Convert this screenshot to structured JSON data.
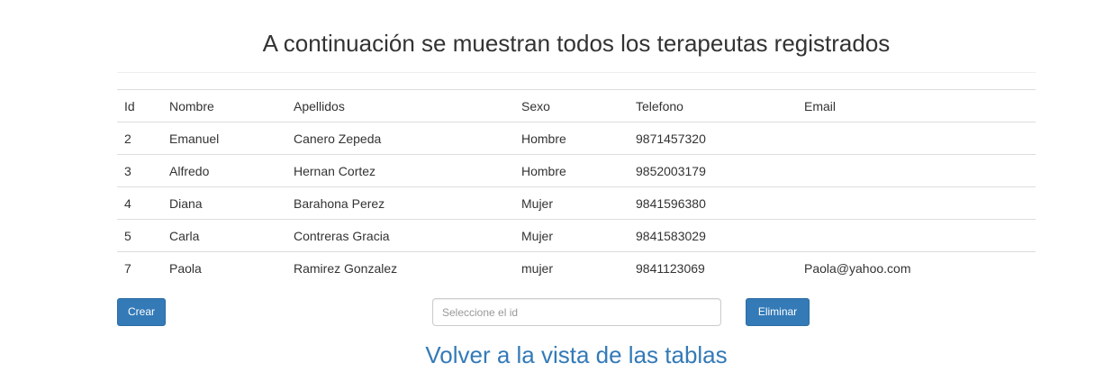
{
  "header": {
    "title": "A continuación se muestran todos los terapeutas registrados"
  },
  "table": {
    "columns": [
      "Id",
      "Nombre",
      "Apellidos",
      "Sexo",
      "Telefono",
      "Email"
    ],
    "rows": [
      [
        "2",
        "Emanuel",
        "Canero Zepeda",
        "Hombre",
        "9871457320",
        ""
      ],
      [
        "3",
        "Alfredo",
        "Hernan Cortez",
        "Hombre",
        "9852003179",
        ""
      ],
      [
        "4",
        "Diana",
        "Barahona Perez",
        "Mujer",
        "9841596380",
        ""
      ],
      [
        "5",
        "Carla",
        "Contreras Gracia",
        "Mujer",
        "9841583029",
        ""
      ],
      [
        "7",
        "Paola",
        "Ramirez Gonzalez",
        "mujer",
        "9841123069",
        "Paola@yahoo.com"
      ]
    ]
  },
  "actions": {
    "create_label": "Crear",
    "id_placeholder": "Seleccione el id",
    "id_value": "",
    "delete_label": "Eliminar"
  },
  "footer": {
    "back_link": "Volver a la vista de las tablas"
  },
  "colors": {
    "primary": "#337ab7",
    "text": "#333333",
    "border": "#dddddd"
  }
}
